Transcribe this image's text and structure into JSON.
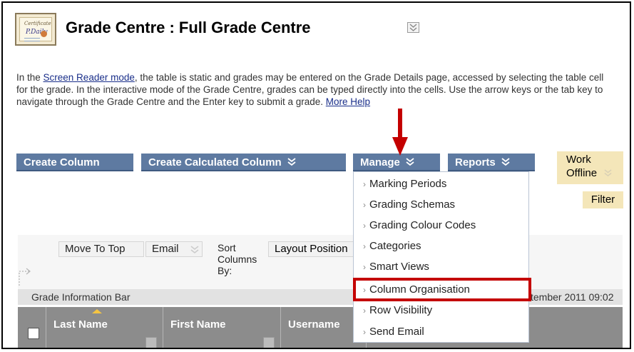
{
  "header": {
    "icon_name": "certificate-icon",
    "icon_text_top": "Certificate",
    "icon_text_script": "P.Daily",
    "title": "Grade Centre : Full Grade Centre"
  },
  "intro": {
    "part1": "In the ",
    "link_screen_reader": "Screen Reader mode",
    "part2": ", the table is static and grades may be entered on the Grade Details page, accessed by selecting the table cell for the grade. In the interactive mode of the Grade Centre, grades can be typed directly into the cells. Use the arrow keys or the tab key to navigate through the Grade Centre and the Enter key to submit a grade. ",
    "link_more_help": "More Help"
  },
  "action_bar": {
    "create_column": "Create Column",
    "create_calculated_column": "Create Calculated Column",
    "manage": "Manage",
    "reports": "Reports",
    "work_offline_line1": "Work",
    "work_offline_line2": "Offline",
    "filter": "Filter"
  },
  "manage_menu": {
    "items": [
      "Marking Periods",
      "Grading Schemas",
      "Grading Colour Codes",
      "Categories",
      "Smart Views",
      "Column Organisation",
      "Row Visibility",
      "Send Email"
    ],
    "highlighted_item": "Column Organisation"
  },
  "toolbar": {
    "move_to_top": "Move To Top",
    "email": "Email",
    "sort_label_line1": "Sort",
    "sort_label_line2": "Columns",
    "sort_label_line3": "By:",
    "sort_value": "Layout Position"
  },
  "info_bar": {
    "label": "Grade Information Bar",
    "timestamp_visible": "tember 2011 09:02"
  },
  "grid": {
    "columns": [
      "Last Name",
      "First Name",
      "Username"
    ]
  },
  "colors": {
    "button_blue": "#5e7aa1",
    "work_offline_bg": "#f4e6b9",
    "annotation_red": "#c40000",
    "grid_header_gray": "#8c8c8c"
  }
}
